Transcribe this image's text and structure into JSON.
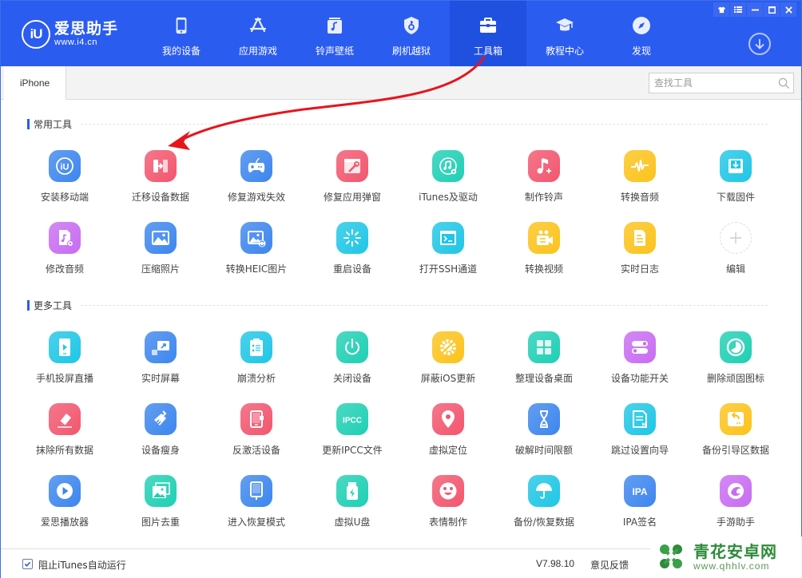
{
  "app": {
    "name": "爱思助手",
    "url": "www.i4.cn",
    "logo_mark": "iU"
  },
  "nav": [
    {
      "label": "我的设备",
      "icon": "phone-icon",
      "active": false
    },
    {
      "label": "应用游戏",
      "icon": "app-store-icon",
      "active": false
    },
    {
      "label": "铃声壁纸",
      "icon": "music-icon",
      "active": false
    },
    {
      "label": "刷机越狱",
      "icon": "shield-key-icon",
      "active": false
    },
    {
      "label": "工具箱",
      "icon": "toolbox-icon",
      "active": true
    },
    {
      "label": "教程中心",
      "icon": "graduation-cap-icon",
      "active": false
    },
    {
      "label": "发现",
      "icon": "compass-icon",
      "active": false
    }
  ],
  "window_controls": {
    "skin": "shirt-icon",
    "menu": "menu-icon",
    "minimize": "minimize-icon",
    "maximize": "maximize-icon",
    "close": "close-icon"
  },
  "tabs": [
    {
      "label": "iPhone",
      "active": true
    }
  ],
  "search": {
    "placeholder": "查找工具",
    "value": ""
  },
  "sections": {
    "common": {
      "title": "常用工具",
      "tools": [
        {
          "label": "安装移动端",
          "icon": "i4-install-icon",
          "color": "#3d86ee"
        },
        {
          "label": "迁移设备数据",
          "icon": "migrate-data-icon",
          "color": "#f2566e"
        },
        {
          "label": "修复游戏失效",
          "icon": "gamepad-icon",
          "color": "#3d86ee"
        },
        {
          "label": "修复应用弹窗",
          "icon": "window-wrench-icon",
          "color": "#f2566e"
        },
        {
          "label": "iTunes及驱动",
          "icon": "itunes-driver-icon",
          "color": "#1fcfb4"
        },
        {
          "label": "制作铃声",
          "icon": "music-note-plus-icon",
          "color": "#f2566e"
        },
        {
          "label": "转换音频",
          "icon": "waveform-icon",
          "color": "#fcc31c"
        },
        {
          "label": "下载固件",
          "icon": "download-firmware-icon",
          "color": "#1fc6e6"
        },
        {
          "label": "修改音频",
          "icon": "audio-file-gear-icon",
          "color": "#c86cf2"
        },
        {
          "label": "压缩照片",
          "icon": "image-icon",
          "color": "#3d86ee"
        },
        {
          "label": "转换HEIC图片",
          "icon": "image-convert-icon",
          "color": "#3d86ee"
        },
        {
          "label": "重启设备",
          "icon": "restart-spinner-icon",
          "color": "#1fc6e6"
        },
        {
          "label": "打开SSH通道",
          "icon": "terminal-icon",
          "color": "#1fc6e6"
        },
        {
          "label": "转换视频",
          "icon": "video-camera-icon",
          "color": "#fcc31c"
        },
        {
          "label": "实时日志",
          "icon": "log-document-icon",
          "color": "#fcc31c"
        },
        {
          "label": "编辑",
          "icon": "plus-icon",
          "color": "#ffffff"
        }
      ]
    },
    "more": {
      "title": "更多工具",
      "tools": [
        {
          "label": "手机投屏直播",
          "icon": "phone-play-icon",
          "color": "#1fc6e6"
        },
        {
          "label": "实时屏幕",
          "icon": "screen-mirror-icon",
          "color": "#3d86ee"
        },
        {
          "label": "崩溃分析",
          "icon": "clipboard-list-icon",
          "color": "#1fc6e6"
        },
        {
          "label": "关闭设备",
          "icon": "power-icon",
          "color": "#1fcfb4"
        },
        {
          "label": "屏蔽iOS更新",
          "icon": "gear-blocked-icon",
          "color": "#fcc31c"
        },
        {
          "label": "整理设备桌面",
          "icon": "grid-icon",
          "color": "#1fcfb4"
        },
        {
          "label": "设备功能开关",
          "icon": "toggle-switches-icon",
          "color": "#c86cf2"
        },
        {
          "label": "删除顽固图标",
          "icon": "pie-clock-icon",
          "color": "#1fcfb4"
        },
        {
          "label": "抹除所有数据",
          "icon": "eraser-icon",
          "color": "#f2566e"
        },
        {
          "label": "设备瘦身",
          "icon": "brush-icon",
          "color": "#3d86ee"
        },
        {
          "label": "反激活设备",
          "icon": "tablet-deactivate-icon",
          "color": "#f2566e"
        },
        {
          "label": "更新IPCC文件",
          "icon": "ipcc-icon",
          "color": "#1fcfb4"
        },
        {
          "label": "虚拟定位",
          "icon": "location-pin-icon",
          "color": "#f2566e"
        },
        {
          "label": "破解时间限额",
          "icon": "hourglass-icon",
          "color": "#3d86ee"
        },
        {
          "label": "跳过设置向导",
          "icon": "skip-setup-icon",
          "color": "#1fc6e6"
        },
        {
          "label": "备份引导区数据",
          "icon": "drive-backup-icon",
          "color": "#fcc31c"
        },
        {
          "label": "爱思播放器",
          "icon": "play-circle-icon",
          "color": "#3d86ee"
        },
        {
          "label": "图片去重",
          "icon": "images-dedupe-icon",
          "color": "#1fcfb4"
        },
        {
          "label": "进入恢复模式",
          "icon": "tablet-cable-icon",
          "color": "#3d86ee"
        },
        {
          "label": "虚拟U盘",
          "icon": "usb-drive-icon",
          "color": "#1fcfb4"
        },
        {
          "label": "表情制作",
          "icon": "smiley-icon",
          "color": "#f2566e"
        },
        {
          "label": "备份/恢复数据",
          "icon": "umbrella-icon",
          "color": "#1fc6e6"
        },
        {
          "label": "IPA签名",
          "icon": "ipa-icon",
          "color": "#3d86ee"
        },
        {
          "label": "手游助手",
          "icon": "game-assistant-icon",
          "color": "#c86cf2"
        }
      ]
    }
  },
  "footer": {
    "checkbox_label": "阻止iTunes自动运行",
    "checkbox_checked": true,
    "version": "V7.98.10",
    "feedback": "意见反馈"
  },
  "watermark": {
    "name": "青花安卓网",
    "url": "www.qhhlv.com"
  },
  "colors": {
    "brand": "#2b5cf0",
    "annotation_arrow": "#e8141c"
  }
}
